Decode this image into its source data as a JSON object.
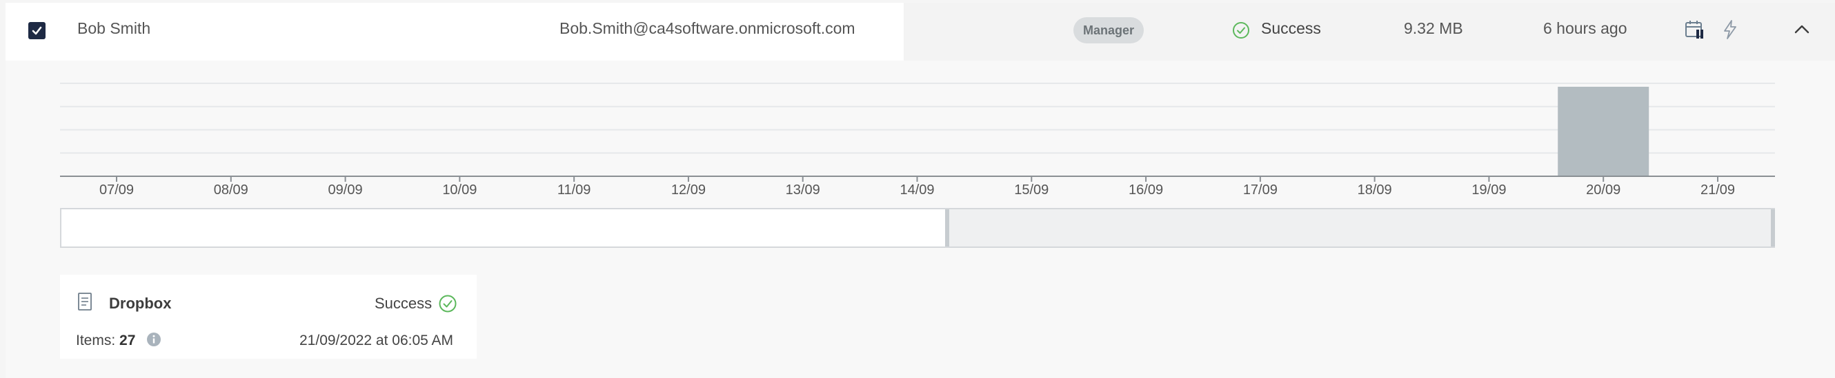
{
  "row": {
    "checked": true,
    "name": "Bob Smith",
    "email": "Bob.Smith@ca4software.onmicrosoft.com",
    "role_badge": "Manager",
    "status": "Success",
    "size": "9.32 MB",
    "last_backup": "6 hours ago",
    "icons": [
      "calendar-pause-icon",
      "bolt-icon",
      "chevron-up-icon"
    ]
  },
  "chart_data": {
    "type": "bar",
    "categories": [
      "07/09",
      "08/09",
      "09/09",
      "10/09",
      "11/09",
      "12/09",
      "13/09",
      "14/09",
      "15/09",
      "16/09",
      "17/09",
      "18/09",
      "19/09",
      "20/09",
      "21/09"
    ],
    "values": [
      0,
      0,
      0,
      0,
      0,
      0,
      0,
      0,
      0,
      0,
      0,
      0,
      0,
      1,
      0
    ],
    "ylim": [
      0,
      1
    ],
    "grid": true,
    "bar_color": "#b3bcc1"
  },
  "range_selector": {
    "selected_from": "14/09",
    "selected_to": "21/09"
  },
  "card": {
    "icon": "document-icon",
    "title": "Dropbox",
    "status": "Success",
    "items_label": "Items:",
    "items_value": "27",
    "date": "21/09/2022 at 06:05 AM"
  },
  "colors": {
    "accent_dark": "#1e2a44",
    "success": "#5cb85c",
    "badge_bg": "#d9dcde"
  }
}
